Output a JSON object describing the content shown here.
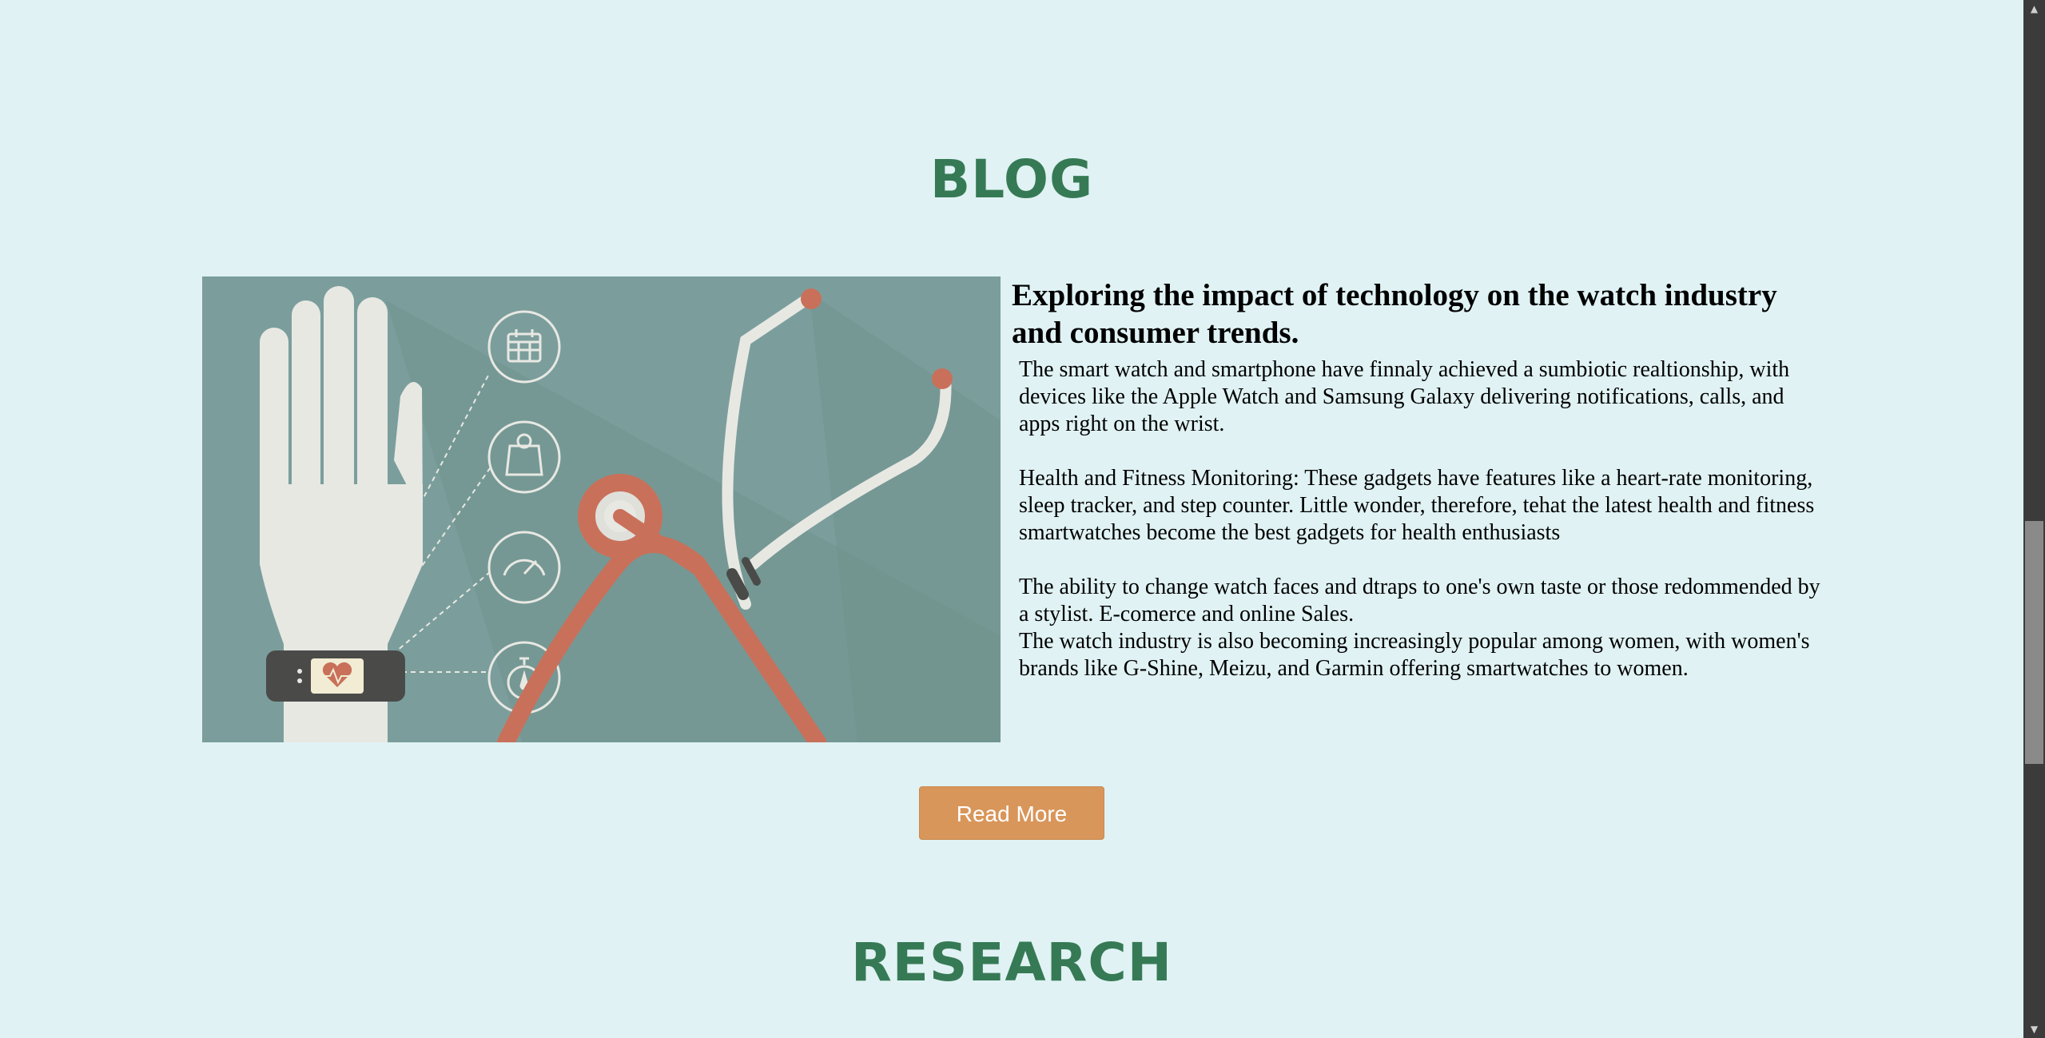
{
  "blog": {
    "section_title": "BLOG",
    "article": {
      "heading": "Exploring the impact of technology on the watch industry and consumer trends.",
      "body": "The smart watch and smartphone have finnaly achieved a sumbiotic realtionship, with devices like the Apple Watch and Samsung Galaxy delivering notifications, calls, and apps right on the wrist.\n\nHealth and Fitness Monitoring: These gadgets have features like a heart-rate monitoring, sleep tracker, and step counter. Little wonder, therefore, tehat the latest health and fitness smartwatches become the best gadgets for health enthusiasts\n\nThe ability to change watch faces and dtraps to one's own taste or those redommended by a stylist. E-comerce and online Sales.\nThe watch industry is also becoming increasingly popular among women, with women's brands like G-Shine, Meizu, and Garmin offering smartwatches to women."
    },
    "read_more_label": "Read More",
    "image_icons": [
      "hand-icon",
      "calendar-icon",
      "scale-icon",
      "speedometer-icon",
      "stopwatch-icon",
      "fitness-band-icon",
      "heart-rate-icon",
      "stethoscope-icon"
    ]
  },
  "research": {
    "section_title": "RESEARCH"
  },
  "colors": {
    "background": "#e0f2f4",
    "section_title": "#367a55",
    "button": "#d9965a",
    "image_bg": "#7b9e9c",
    "accent_red": "#c9705a"
  },
  "scrollbar": {
    "up_arrow": "▲",
    "down_arrow": "▼"
  }
}
